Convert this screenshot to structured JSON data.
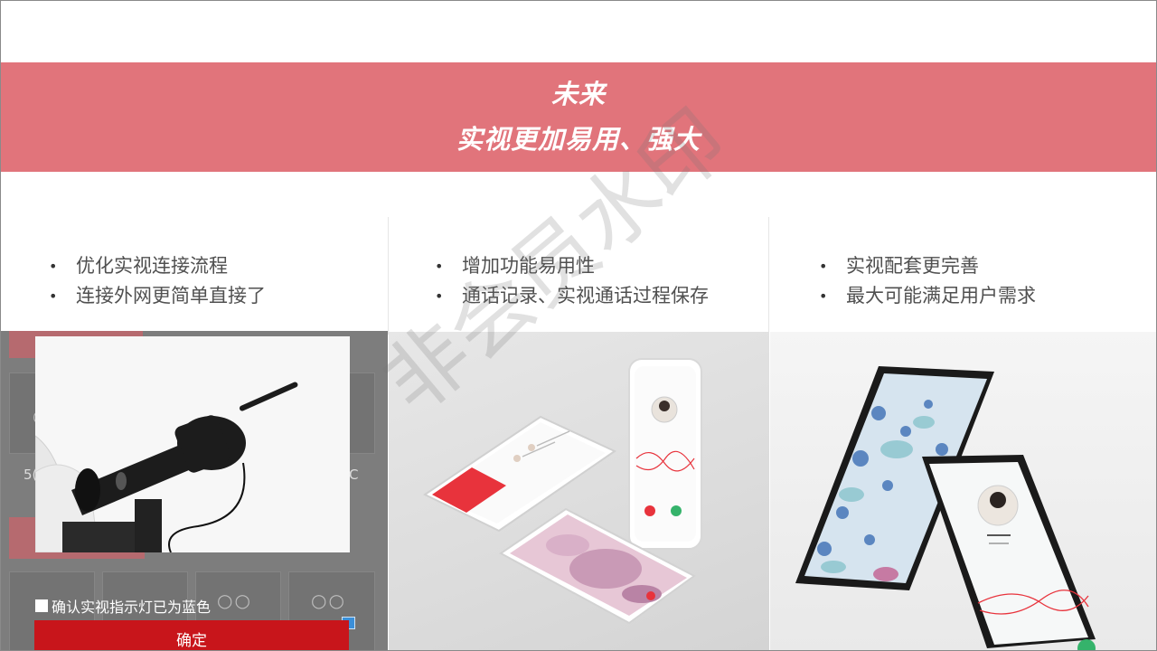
{
  "banner": {
    "line1": "未来",
    "line2": "实视更加易用、强大"
  },
  "columns": [
    {
      "bullets": [
        "优化实视连接流程",
        "连接外网更简单直接了"
      ]
    },
    {
      "bullets": [
        "增加功能易用性",
        "通话记录、实视通话过程保存"
      ]
    },
    {
      "bullets": [
        "实视配套更完善",
        "最大可能满足用户需求"
      ]
    }
  ],
  "bullet_symbol": "•",
  "dialog": {
    "checkbox_label": "确认实视指示灯已为蓝色",
    "confirm_label": "确定"
  },
  "watermark": "非会员水印",
  "colors": {
    "banner": "#e1747b",
    "confirm_button": "#c8151b",
    "accent_red": "#e8333c"
  }
}
